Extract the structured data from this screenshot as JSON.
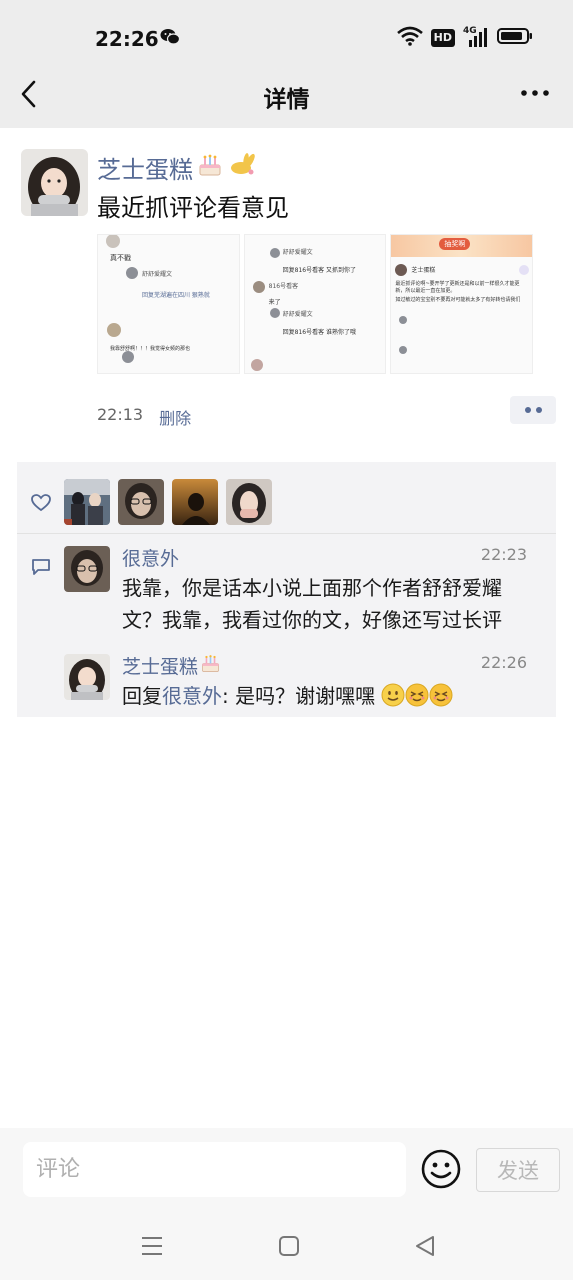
{
  "status_bar": {
    "time": "22:26",
    "network_label": "4G",
    "hd_label": "HD"
  },
  "nav": {
    "title": "详情"
  },
  "post": {
    "author": "芝士蛋糕",
    "text": "最近抓评论看意见",
    "time": "22:13",
    "delete_label": "删除",
    "photos": [
      {
        "lines": [
          "真不戳",
          "舒舒爱耀文",
          "回复芜湖遍在四川 狠熟就",
          "我靠舒舒啊！！！我觉得女频的那也"
        ],
        "highlight": "芜湖遍在四川"
      },
      {
        "lines": [
          "舒舒爱耀文",
          "回复816号看客 又抓到你了",
          "816号看客",
          "来了",
          "舒舒爱耀文",
          "回复816号看客 谁熟你了哦"
        ],
        "highlight": "816号看客"
      },
      {
        "header": "抽奖啊",
        "lines": [
          "芝士蛋糕",
          "最近抓评论啊~要开学了更新还是和以前一样很久才能更新，所以最近一直在加更。",
          "如过敏过的宝宝别不要再对可能就太多了有好转也请我们"
        ],
        "highlight": "芝士蛋糕"
      }
    ]
  },
  "likes": {
    "count": 4
  },
  "comments": [
    {
      "author": "很意外",
      "time": "22:23",
      "lines": [
        "我靠，你是话本小说上面那个作者舒舒爱耀",
        "文？我靠，我看过你的文，好像还写过长评"
      ]
    },
    {
      "author": "芝士蛋糕",
      "time": "22:26",
      "reply_prefix": "回复",
      "reply_to": "很意外",
      "reply_text": ": 是吗？谢谢嘿嘿"
    }
  ],
  "composer": {
    "placeholder": "评论",
    "send_label": "发送"
  },
  "colors": {
    "link": "#576b95",
    "bar_bg": "#ededed",
    "panel_bg": "#f3f3f5"
  },
  "icons": [
    "back-arrow-icon",
    "more-icon",
    "heart-icon",
    "comment-icon",
    "emoji-icon",
    "menu-icon",
    "home-icon",
    "back-triangle-icon",
    "wechat-icon",
    "wifi-icon",
    "signal-icon",
    "battery-icon",
    "cake-emoji-icon",
    "rabbit-emoji-icon"
  ]
}
